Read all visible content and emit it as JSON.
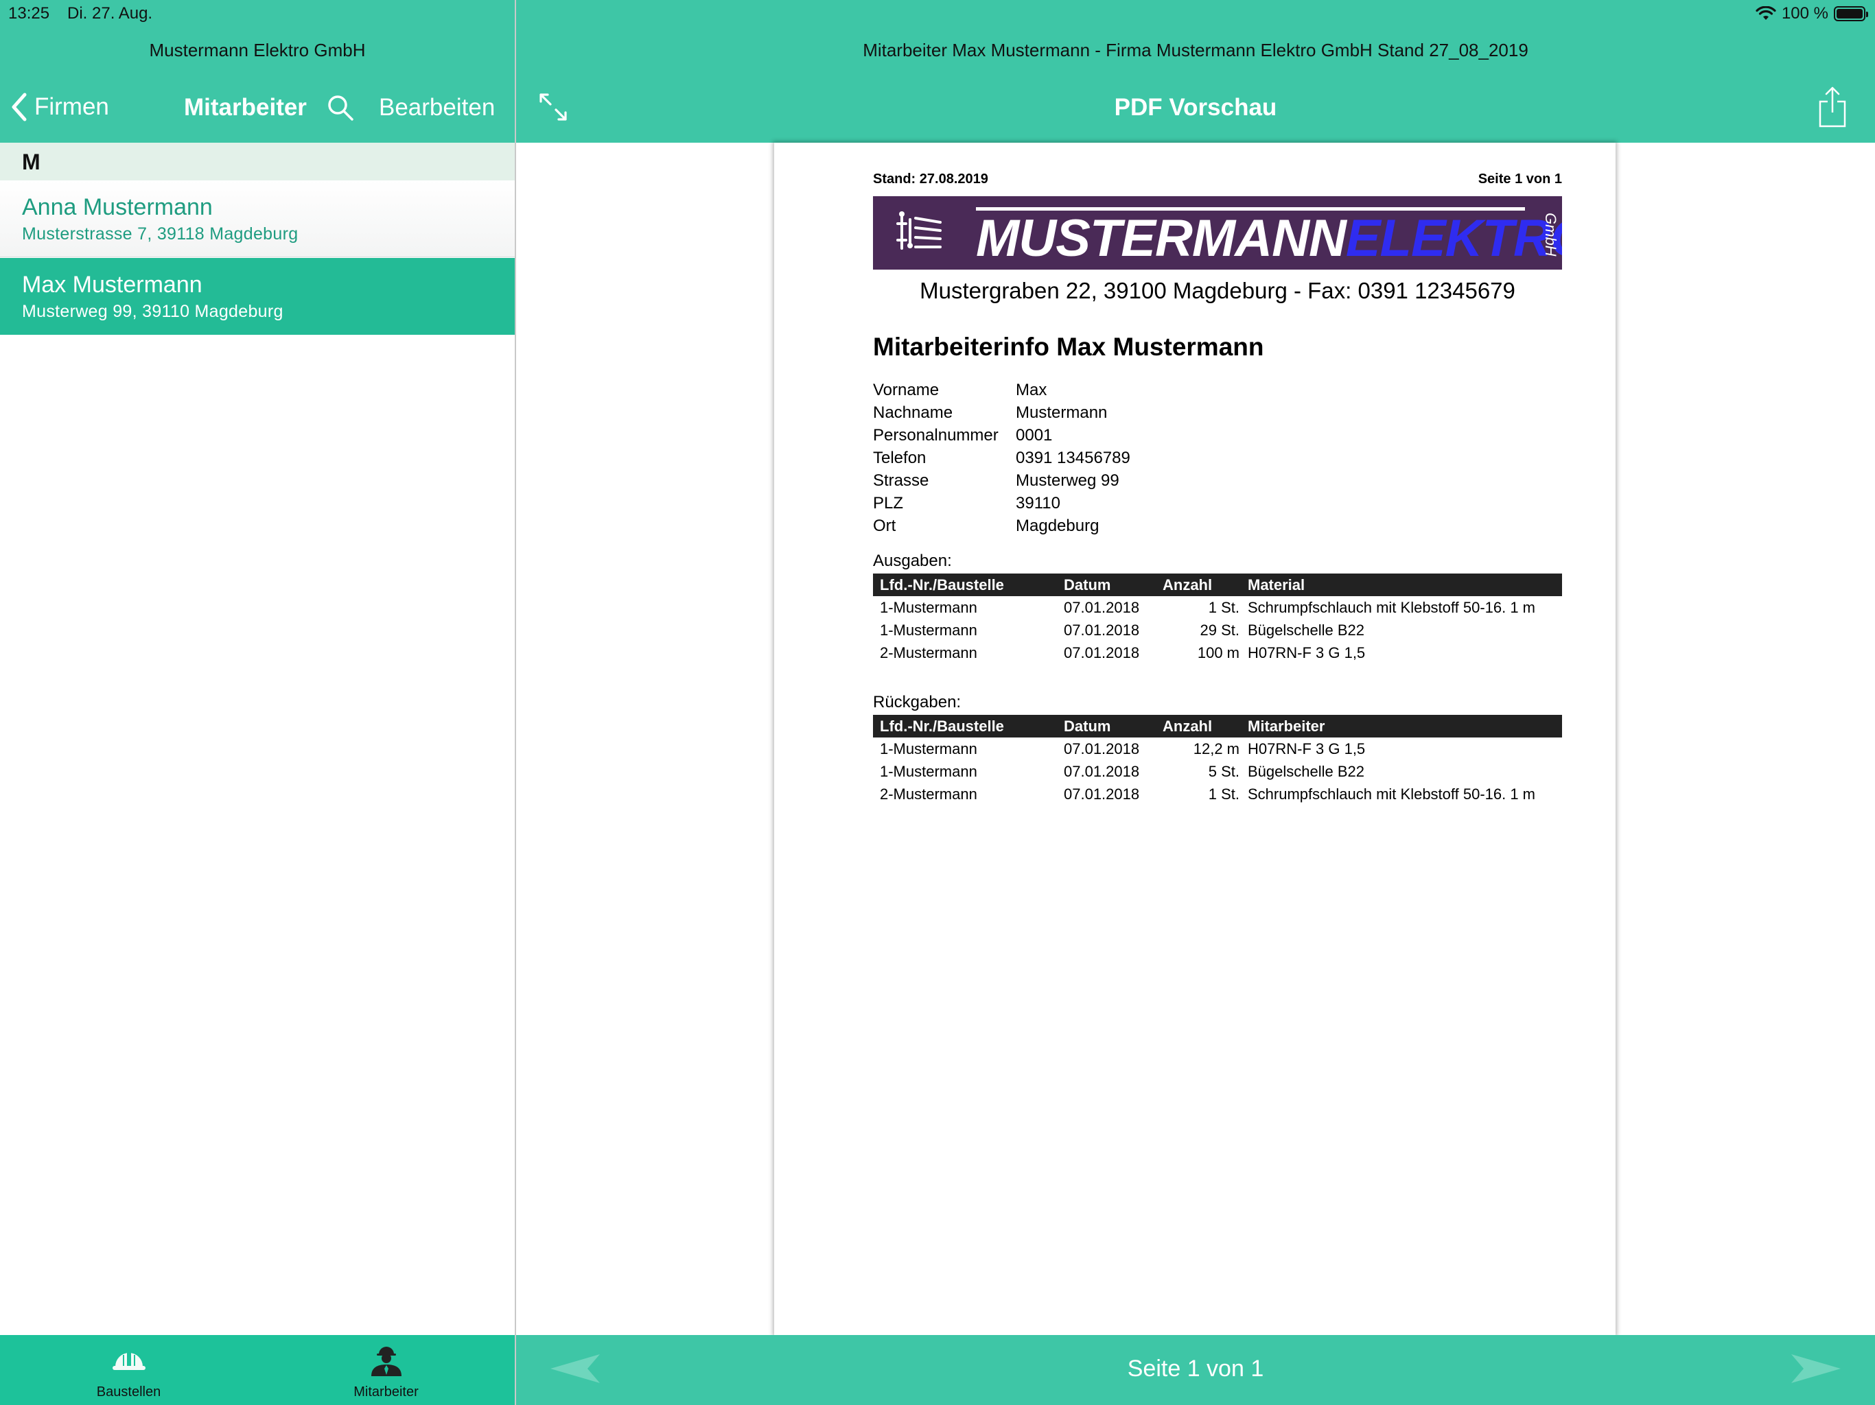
{
  "status_bar": {
    "time": "13:25",
    "date": "Di. 27. Aug.",
    "battery": "100 %",
    "battery_level": 1.0
  },
  "left_pane": {
    "company_title": "Mustermann Elektro GmbH",
    "back_label": "Firmen",
    "title": "Mitarbeiter",
    "edit_label": "Bearbeiten",
    "section_letter": "M",
    "employees": [
      {
        "name": "Anna Mustermann",
        "address": "Musterstrasse 7, 39118 Magdeburg",
        "selected": false
      },
      {
        "name": "Max Mustermann",
        "address": "Musterweg 99, 39110 Magdeburg",
        "selected": true
      }
    ],
    "tabs": [
      {
        "label": "Baustellen",
        "icon": "hard-hat-icon"
      },
      {
        "label": "Mitarbeiter",
        "icon": "worker-icon"
      }
    ]
  },
  "right_pane": {
    "document_title": "Mitarbeiter Max Mustermann - Firma Mustermann Elektro GmbH Stand 27_08_2019",
    "title": "PDF Vorschau",
    "page_indicator": "Seite 1 von 1"
  },
  "pdf": {
    "stand": "Stand: 27.08.2019",
    "seite": "Seite 1 von 1",
    "banner": {
      "word1": "MUSTERMANN",
      "word2": "ELEKTRO",
      "suffix": "GmbH",
      "background": "#4a2a57",
      "accent": "#2f2cf0"
    },
    "company_line": "Mustergraben 22, 39100 Magdeburg  -  Fax: 0391 12345679",
    "heading": "Mitarbeiterinfo Max Mustermann",
    "info": [
      {
        "label": "Vorname",
        "value": "Max"
      },
      {
        "label": "Nachname",
        "value": "Mustermann"
      },
      {
        "label": "Personalnummer",
        "value": "0001"
      },
      {
        "label": "Telefon",
        "value": "0391 13456789"
      },
      {
        "label": "Strasse",
        "value": "Musterweg 99"
      },
      {
        "label": "PLZ",
        "value": "39110"
      },
      {
        "label": "Ort",
        "value": "Magdeburg"
      }
    ],
    "ausgaben": {
      "label": "Ausgaben:",
      "headers": [
        "Lfd.-Nr./Baustelle",
        "Datum",
        "Anzahl",
        "Material"
      ],
      "rows": [
        [
          "1-Mustermann",
          "07.01.2018",
          "1 St.",
          "Schrumpfschlauch mit Klebstoff 50-16. 1 m"
        ],
        [
          "1-Mustermann",
          "07.01.2018",
          "29 St.",
          "Bügelschelle B22"
        ],
        [
          "2-Mustermann",
          "07.01.2018",
          "100 m",
          "H07RN-F 3 G 1,5"
        ]
      ]
    },
    "rueckgaben": {
      "label": "Rückgaben:",
      "headers": [
        "Lfd.-Nr./Baustelle",
        "Datum",
        "Anzahl",
        "Mitarbeiter"
      ],
      "rows": [
        [
          "1-Mustermann",
          "07.01.2018",
          "12,2 m",
          "H07RN-F 3 G 1,5"
        ],
        [
          "1-Mustermann",
          "07.01.2018",
          "5 St.",
          "Bügelschelle B22"
        ],
        [
          "2-Mustermann",
          "07.01.2018",
          "1 St.",
          "Schrumpfschlauch mit Klebstoff 50-16. 1 m"
        ]
      ]
    }
  },
  "colors": {
    "header": "#3ec6a6",
    "selected_row": "#23bb96",
    "tabbar": "#1dc29a",
    "section": "#e3f1e9",
    "accent_text": "#1e9c80"
  }
}
